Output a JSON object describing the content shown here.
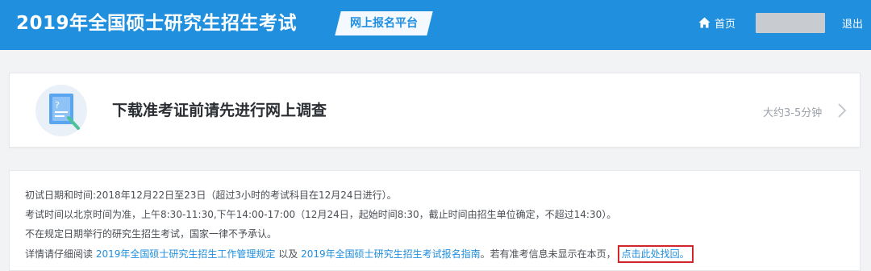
{
  "header": {
    "title": "2019年全国硕士研究生招生考试",
    "platform_badge": "网上报名平台",
    "home_label": "首页",
    "logout_label": "退出",
    "home_icon": "home-icon"
  },
  "survey": {
    "icon": "questionnaire-icon",
    "title": "下载准考证前请先进行网上调查",
    "duration": "大约3-5分钟",
    "chevron_icon": "chevron-right-icon"
  },
  "info": {
    "line1": "初试日期和时间:2018年12月22日至23日（超过3小时的考试科目在12月24日进行）。",
    "line2": "考试时间以北京时间为准，上午8:30-11:30,下午14:00-17:00（12月24日，起始时间8:30，截止时间由招生单位确定，不超过14:30）。",
    "line3": "不在规定日期举行的研究生招生考试，国家一律不予承认。",
    "line4_prefix": "详情请仔细阅读",
    "link1": "2019年全国硕士研究生招生工作管理规定",
    "line4_mid": "以及",
    "link2": "2019年全国硕士研究生招生考试报名指南",
    "line4_suffix": "。若有准考信息未显示在本页，",
    "recover_link": "点击此处找回",
    "line4_end": "。"
  },
  "colors": {
    "brand_blue": "#1f8fde",
    "highlight_red": "#d0252b"
  }
}
